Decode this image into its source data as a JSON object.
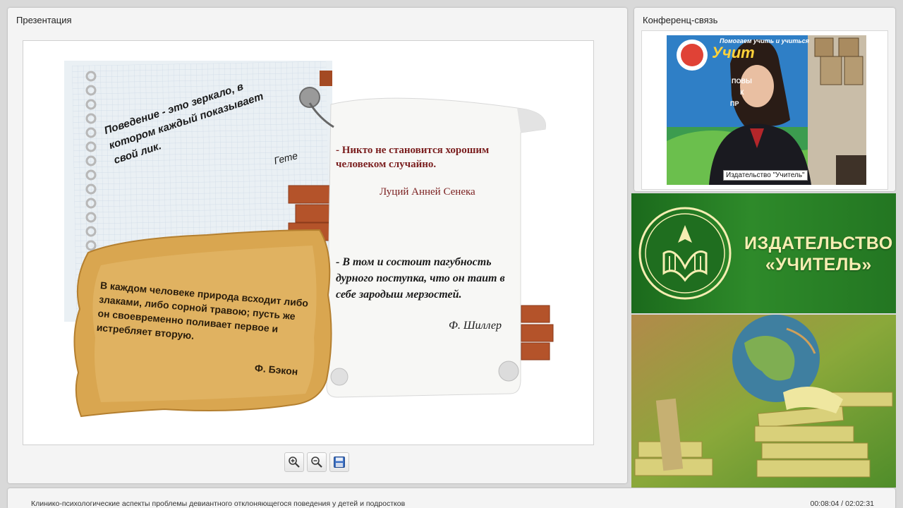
{
  "presentation": {
    "title": "Презентация",
    "slide": {
      "quote_goethe": {
        "text": "Поведение - это зеркало, в котором каждый показывает свой лик.",
        "author": "Гете"
      },
      "quote_seneca": {
        "text": "- Никто не становится хорошим человеком случайно.",
        "author": "Луций Анней Сенека"
      },
      "quote_schiller": {
        "text": "- В том и состоит пагубность дурного поступка, что он таит в себе зародыш мерзостей.",
        "author": "Ф. Шиллер"
      },
      "quote_bacon": {
        "text": "В каждом человеке природа всходит либо злаками, либо сорной травою; пусть же он своевременно поливает первое и истребляет вторую.",
        "author": "Ф. Бэкон"
      }
    },
    "toolbar": {
      "zoom_in_icon": "zoom-in-icon",
      "zoom_out_icon": "zoom-out-icon",
      "save_icon": "save-icon"
    }
  },
  "conference": {
    "title": "Конференц-связь",
    "participant_name": "Издательство \"Учитель\"",
    "backdrop_text": {
      "slogan": "Помогаем учить и учиться",
      "brand": "Учит",
      "items": [
        "ПОВЫ",
        "К",
        "ПР"
      ]
    }
  },
  "publisher": {
    "line1": "ИЗДАТЕЛЬСТВО",
    "line2": "«УЧИТЕЛЬ»"
  },
  "status": {
    "lecture_title": "Клинико-психологические аспекты проблемы девиантного отклоняющегося поведения у детей и подростков",
    "time": "00:08:04 / 02:02:31"
  },
  "colors": {
    "publisher_green": "#237622",
    "publisher_text": "#f6eeb2",
    "quote_maroon": "#7a1e1e",
    "parchment": "#d9a650"
  }
}
